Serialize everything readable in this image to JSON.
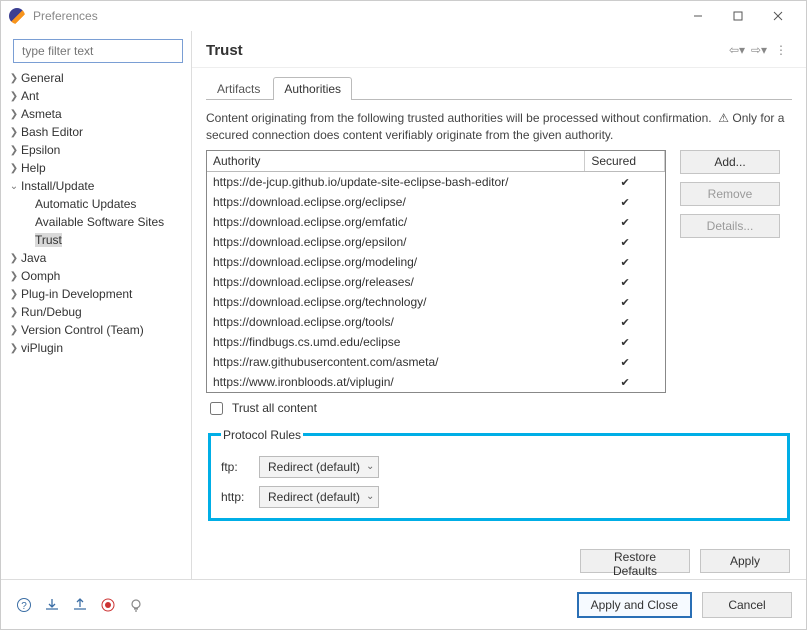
{
  "window": {
    "title": "Preferences"
  },
  "filter": {
    "placeholder": "type filter text"
  },
  "tree": {
    "items": [
      {
        "label": "General",
        "expandable": true
      },
      {
        "label": "Ant",
        "expandable": true
      },
      {
        "label": "Asmeta",
        "expandable": true
      },
      {
        "label": "Bash Editor",
        "expandable": true
      },
      {
        "label": "Epsilon",
        "expandable": true
      },
      {
        "label": "Help",
        "expandable": true
      },
      {
        "label": "Install/Update",
        "expandable": true,
        "expanded": true,
        "children": [
          {
            "label": "Automatic Updates"
          },
          {
            "label": "Available Software Sites"
          },
          {
            "label": "Trust",
            "selected": true
          }
        ]
      },
      {
        "label": "Java",
        "expandable": true
      },
      {
        "label": "Oomph",
        "expandable": true
      },
      {
        "label": "Plug-in Development",
        "expandable": true
      },
      {
        "label": "Run/Debug",
        "expandable": true
      },
      {
        "label": "Version Control (Team)",
        "expandable": true
      },
      {
        "label": "viPlugin",
        "expandable": true
      }
    ]
  },
  "header": {
    "title": "Trust"
  },
  "tabs": {
    "items": [
      "Artifacts",
      "Authorities"
    ],
    "activeIndex": 1
  },
  "description": {
    "text": "Content originating from the following trusted authorities will be processed without confirmation. ",
    "warning": "⚠ Only for a secured connection does content verifiably originate from the given authority."
  },
  "table": {
    "columns": {
      "c0": "Authority",
      "c1": "Secured"
    },
    "rows": [
      "https://de-jcup.github.io/update-site-eclipse-bash-editor/",
      "https://download.eclipse.org/eclipse/",
      "https://download.eclipse.org/emfatic/",
      "https://download.eclipse.org/epsilon/",
      "https://download.eclipse.org/modeling/",
      "https://download.eclipse.org/releases/",
      "https://download.eclipse.org/technology/",
      "https://download.eclipse.org/tools/",
      "https://findbugs.cs.umd.edu/eclipse",
      "https://raw.githubusercontent.com/asmeta/",
      "https://www.ironbloods.at/viplugin/"
    ]
  },
  "sideButtons": {
    "add": "Add...",
    "remove": "Remove",
    "details": "Details..."
  },
  "trustAll": {
    "label": "Trust all content",
    "checked": false
  },
  "protocol": {
    "title": "Protocol Rules",
    "rows": [
      {
        "label": "ftp:",
        "value": "Redirect (default)"
      },
      {
        "label": "http:",
        "value": "Redirect (default)"
      }
    ]
  },
  "pageButtons": {
    "restoreDefaults": "Restore Defaults",
    "apply": "Apply"
  },
  "footerButtons": {
    "applyClose": "Apply and Close",
    "cancel": "Cancel"
  }
}
